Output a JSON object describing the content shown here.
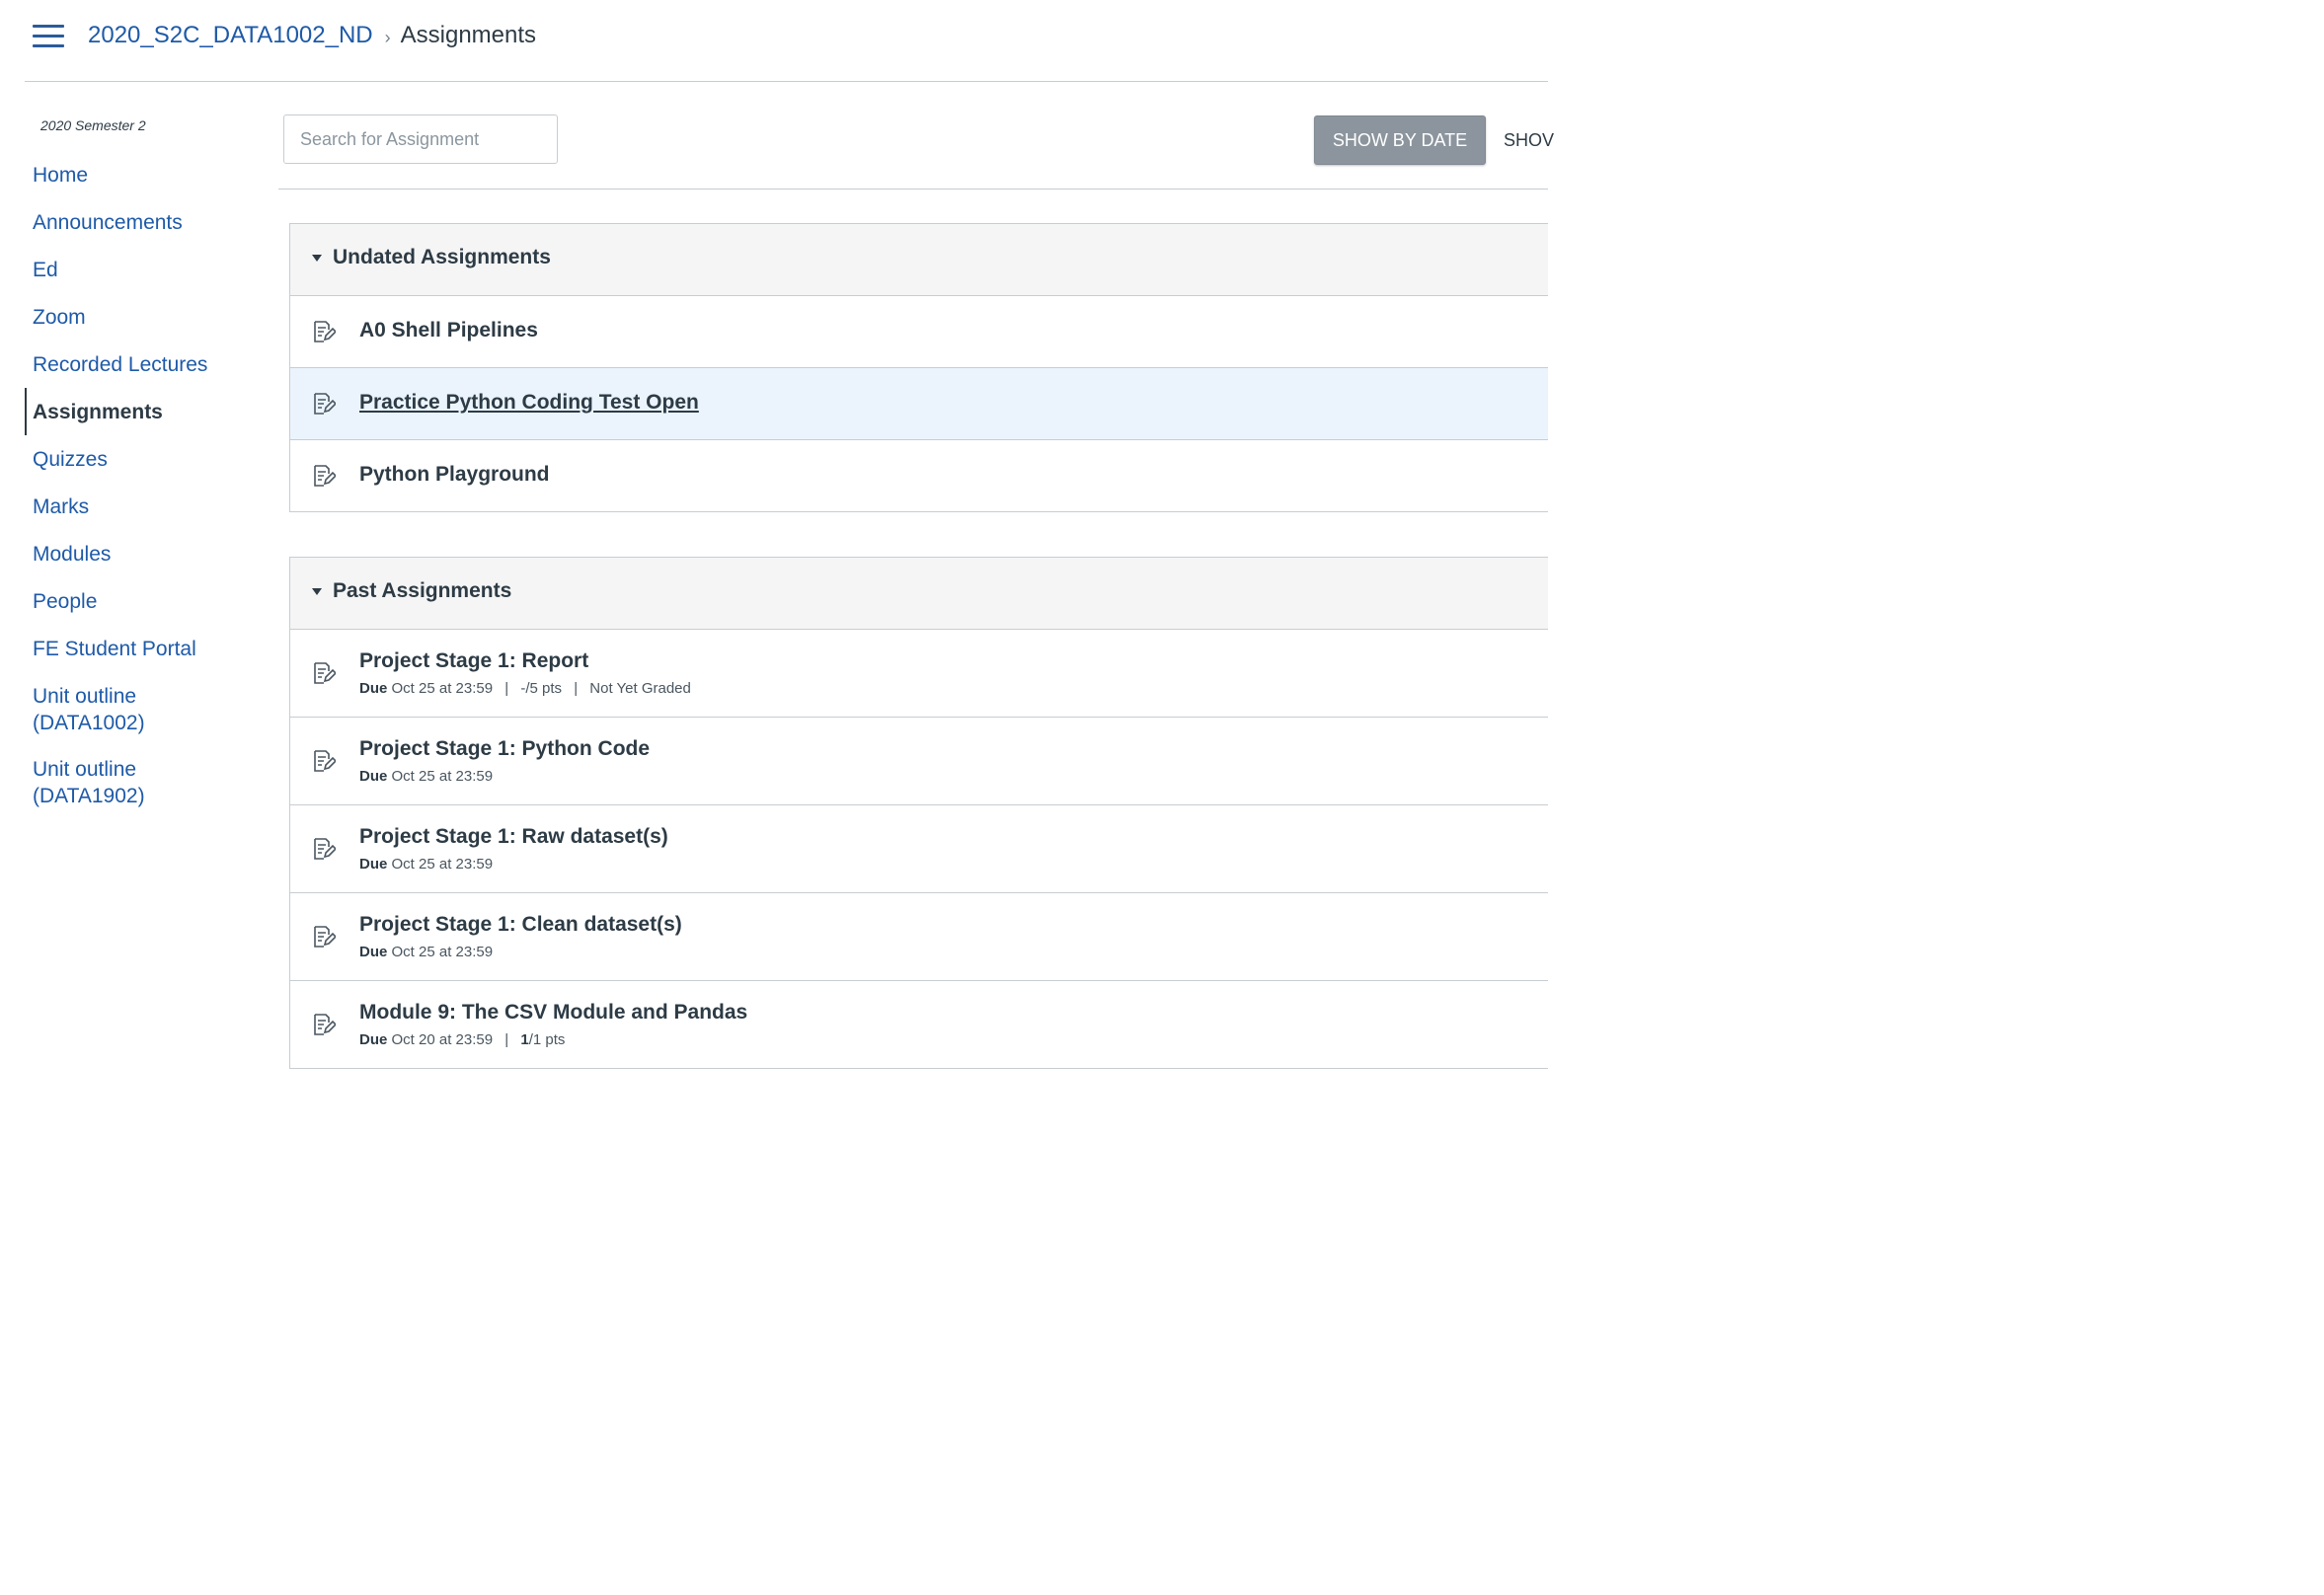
{
  "header": {
    "course": "2020_S2C_DATA1002_ND",
    "separator": "›",
    "current": "Assignments"
  },
  "sidebar": {
    "term": "2020 Semester 2",
    "items": [
      {
        "label": "Home"
      },
      {
        "label": "Announcements"
      },
      {
        "label": "Ed"
      },
      {
        "label": "Zoom"
      },
      {
        "label": "Recorded Lectures"
      },
      {
        "label": "Assignments",
        "active": true
      },
      {
        "label": "Quizzes"
      },
      {
        "label": "Marks"
      },
      {
        "label": "Modules"
      },
      {
        "label": "People"
      },
      {
        "label": "FE Student Portal"
      },
      {
        "label": "Unit outline (DATA1002)",
        "line1": "Unit outline",
        "line2": "(DATA1002)"
      },
      {
        "label": "Unit outline (DATA1902)",
        "line1": "Unit outline",
        "line2": "(DATA1902)"
      }
    ]
  },
  "toolbar": {
    "search_placeholder": "Search for Assignment",
    "show_by_date": "SHOW BY DATE",
    "show_by_type": "SHOW BY TYPE",
    "show_by_type_visible": "SHOV"
  },
  "groups": [
    {
      "title": "Undated Assignments",
      "assignments": [
        {
          "title": "A0 Shell Pipelines"
        },
        {
          "title": "Practice Python Coding Test Open"
        },
        {
          "title": "Python Playground"
        }
      ]
    },
    {
      "title": "Past Assignments",
      "assignments": [
        {
          "title": "Project Stage 1: Report",
          "due_label": "Due",
          "due": "Oct 25 at 23:59",
          "points": "-/5 pts",
          "status": "Not Yet Graded"
        },
        {
          "title": "Project Stage 1: Python Code",
          "due_label": "Due",
          "due": "Oct 25 at 23:59"
        },
        {
          "title": "Project Stage 1: Raw dataset(s)",
          "due_label": "Due",
          "due": "Oct 25 at 23:59"
        },
        {
          "title": "Project Stage 1: Clean dataset(s)",
          "due_label": "Due",
          "due": "Oct 25 at 23:59"
        },
        {
          "title": "Module 9: The CSV Module and Pandas",
          "due_label": "Due",
          "due": "Oct 20 at 23:59",
          "score": "1",
          "points": "/1 pts"
        }
      ]
    }
  ],
  "colors": {
    "link": "#1e5aa8",
    "text": "#2d3b45",
    "header_bg": "#f5f5f5",
    "highlight_row": "#ebf4fc",
    "button_bg": "#8c959d"
  }
}
